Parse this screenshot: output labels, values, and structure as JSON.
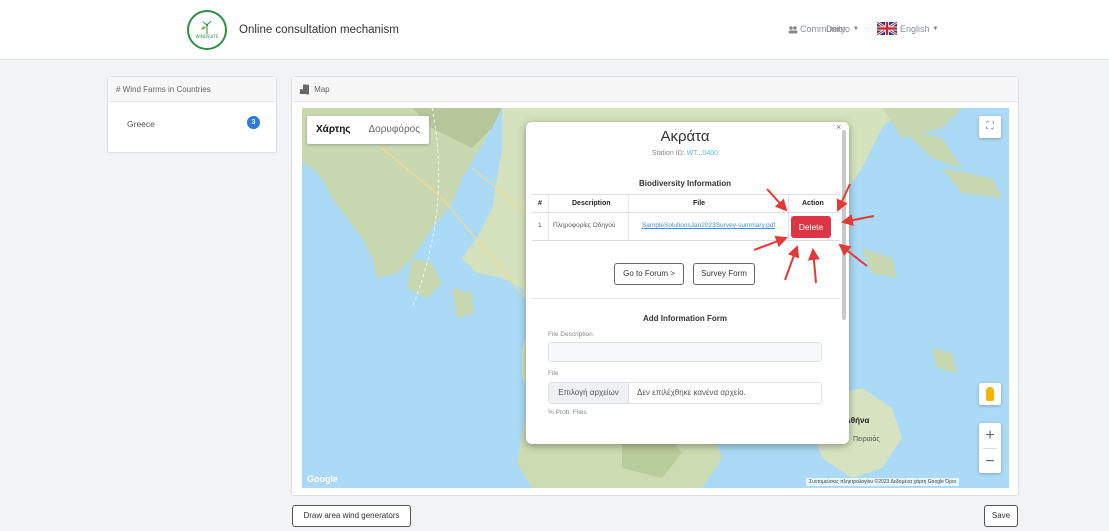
{
  "navbar": {
    "logo_text": "WINDSUITE",
    "brand": "Online consultation mechanism",
    "community": "Community",
    "demo": "Demo",
    "language": "English"
  },
  "sidebar": {
    "title": "# Wind Farms in Countries",
    "items": [
      {
        "label": "Greece",
        "count": "3"
      }
    ]
  },
  "map_card": {
    "title": "Map",
    "map_types": [
      "Χάρτης",
      "Δορυφόρος"
    ],
    "labels": {
      "athens": "Αθήνα",
      "piraeus": "Πειραιάς"
    },
    "google": "Google",
    "attribution": "Συντομεύσεις πληκτρολογίου  ©2023 Δεδομένα χάρτη Google  Όροι"
  },
  "popup": {
    "title": "Ακράτα",
    "station_label": "Station ID:",
    "station_id": "WT...0400",
    "bio_title": "Biodiversity Information",
    "columns": [
      "#",
      "Description",
      "File",
      "Action"
    ],
    "rows": [
      {
        "num": "1",
        "description": "Πληροφορίες Οδηγού",
        "file": "SampleSolutionsJan2023Survey-summary.pdf",
        "action": "Delete"
      }
    ],
    "forum_button": "Go to Forum >",
    "survey_button": "Survey Form",
    "add_title": "Add Information Form",
    "file_description_label": "File Description",
    "file_label": "File",
    "choose_files": "Επιλογή αρχείων",
    "no_file": "Δεν επιλέχθηκε κανένα αρχείο.",
    "next_label": "% Prob. Files"
  },
  "bottom": {
    "draw_button": "Draw area wind generators",
    "save_button": "Save"
  }
}
